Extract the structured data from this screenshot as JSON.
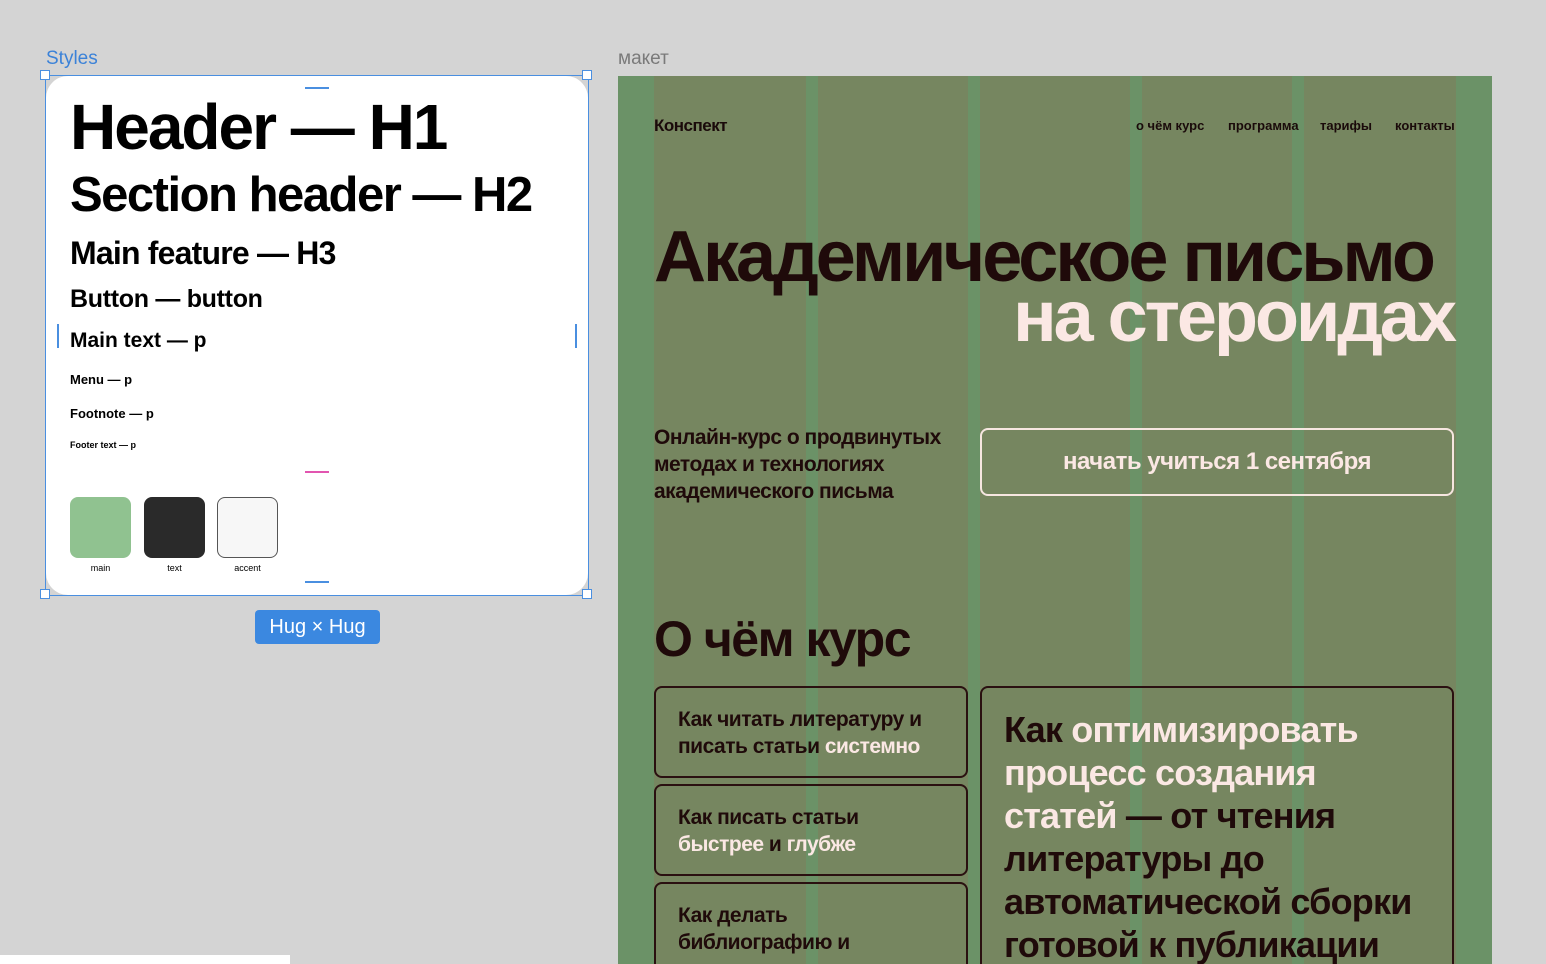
{
  "frames": {
    "styles_label": "Styles",
    "maket_label": "макет",
    "size_badge": "Hug × Hug"
  },
  "styles": {
    "h1": "Header — H1",
    "h2": "Section header — H2",
    "h3": "Main feature — H3",
    "button": "Button — button",
    "main_text": "Main text — p",
    "menu": "Menu — p",
    "footnote": "Footnote — p",
    "footer_text": "Footer text — p",
    "swatches": [
      {
        "label": "main",
        "color": "#90c290"
      },
      {
        "label": "text",
        "color": "#2a2a2a"
      },
      {
        "label": "accent",
        "color": "#f7f7f7"
      }
    ]
  },
  "maket": {
    "logo": "Конспект",
    "nav": [
      "о чём курс",
      "программа",
      "тарифы",
      "контакты"
    ],
    "hero_line1": "Академическое письмо",
    "hero_line2": "на стероидах",
    "subtitle": "Онлайн-курс о продвинутых методах и технологиях академического письма",
    "cta": "начать учиться 1 сентября",
    "section_title": "О чём курс",
    "cards": [
      {
        "a": "Как читать литературу и писать статьи ",
        "b": "системно"
      },
      {
        "a": "Как писать статьи ",
        "b": "быстрее",
        "c": " и ",
        "d": "глубже"
      },
      {
        "a": "Как делать библиографию и"
      }
    ],
    "big_card": {
      "dark1": "Как ",
      "light1": "оптимизировать процесс создания статей",
      "dark2": " — от чтения литературы до автоматической сборки готовой к публикации"
    },
    "colors": {
      "background": "#768660",
      "grid": "#6a9468",
      "text": "#1f0a0a",
      "accent": "#fbe8e4"
    }
  }
}
